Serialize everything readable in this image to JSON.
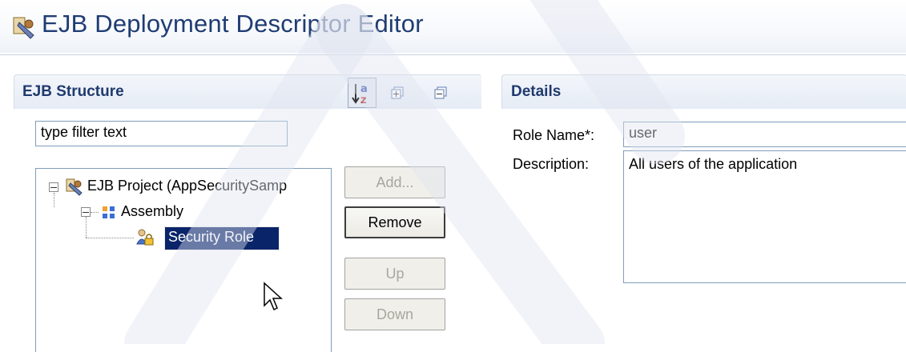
{
  "editor": {
    "title": "EJB Deployment Descriptor Editor"
  },
  "structure": {
    "section_title": "EJB Structure",
    "filter": {
      "value": "type filter text"
    },
    "tree": {
      "project": "EJB Project (AppSecuritySamp",
      "assembly": "Assembly",
      "security_role": "Security Role"
    },
    "buttons": {
      "add": "Add...",
      "remove": "Remove",
      "up": "Up",
      "down": "Down"
    },
    "toolbar_icons": [
      "sort-az-icon",
      "expand-all-icon",
      "collapse-all-icon"
    ]
  },
  "details": {
    "section_title": "Details",
    "role_name_label": "Role Name*:",
    "role_name_value": "user",
    "description_label": "Description:",
    "description_value": "All users of the application"
  },
  "colors": {
    "title": "#1f3c73",
    "selection": "#0a246a",
    "section_title": "#203a6e"
  }
}
